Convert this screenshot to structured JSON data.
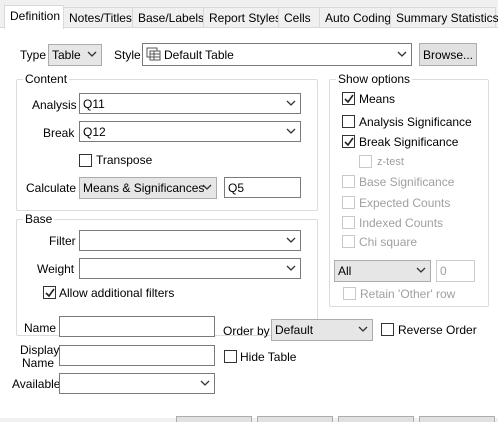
{
  "tabs": [
    {
      "label": "Definition"
    },
    {
      "label": "Notes/Titles"
    },
    {
      "label": "Base/Labels"
    },
    {
      "label": "Report Styles"
    },
    {
      "label": "Cells"
    },
    {
      "label": "Auto Coding"
    },
    {
      "label": "Summary Statistics"
    }
  ],
  "top": {
    "type_label": "Type",
    "type_value": "Table",
    "style_label": "Style",
    "style_value": "Default Table",
    "browse_label": "Browse..."
  },
  "content": {
    "title": "Content",
    "analysis_label": "Analysis",
    "analysis_value": "Q11",
    "break_label": "Break",
    "break_value": "Q12",
    "transpose_label": "Transpose",
    "transpose_checked": false,
    "calculate_label": "Calculate",
    "calculate_value": "Means & Significances",
    "calculate_extra": "Q5"
  },
  "base": {
    "title": "Base",
    "filter_label": "Filter",
    "filter_value": "",
    "weight_label": "Weight",
    "weight_value": "",
    "allow_filters_label": "Allow additional filters",
    "allow_filters_checked": true
  },
  "show_options": {
    "title": "Show options",
    "items": [
      {
        "label": "Means",
        "checked": true,
        "enabled": true
      },
      {
        "label": "Analysis Significance",
        "checked": false,
        "enabled": true
      },
      {
        "label": "Break Significance",
        "checked": true,
        "enabled": true
      },
      {
        "label": "z-test",
        "checked": false,
        "enabled": false
      },
      {
        "label": "Base Significance",
        "checked": false,
        "enabled": false
      },
      {
        "label": "Expected Counts",
        "checked": false,
        "enabled": false
      },
      {
        "label": "Indexed Counts",
        "checked": false,
        "enabled": false
      },
      {
        "label": "Chi square",
        "checked": false,
        "enabled": false
      }
    ],
    "all_value": "All",
    "count_value": "0",
    "retain_label": "Retain 'Other' row"
  },
  "bottom": {
    "name_label": "Name",
    "name_value": "",
    "display_name_label_1": "Display",
    "display_name_label_2": "Name",
    "display_name_value": "",
    "available_label": "Available",
    "available_value": "",
    "order_by_label": "Order by",
    "order_by_value": "Default",
    "reverse_order_label": "Reverse Order",
    "hide_table_label": "Hide Table"
  }
}
